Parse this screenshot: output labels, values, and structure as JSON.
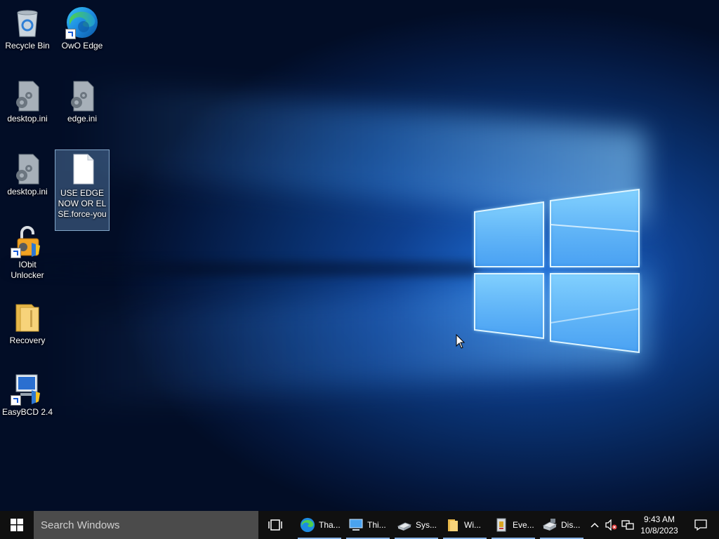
{
  "desktop": {
    "icons": [
      {
        "label": "Recycle Bin"
      },
      {
        "label": "OwO Edge"
      },
      {
        "label": "desktop.ini"
      },
      {
        "label": "edge.ini"
      },
      {
        "label": "desktop.ini"
      },
      {
        "label": "USE EDGE NOW OR ELSE.force-you"
      },
      {
        "label": "IObit Unlocker"
      },
      {
        "label": "Recovery"
      },
      {
        "label": "EasyBCD 2.4"
      }
    ]
  },
  "taskbar": {
    "search_placeholder": "Search Windows",
    "apps": [
      {
        "label": "Tha...",
        "icon": "edge-icon"
      },
      {
        "label": "Thi...",
        "icon": "this-pc-icon"
      },
      {
        "label": "Sys...",
        "icon": "drive-icon"
      },
      {
        "label": "Wi...",
        "icon": "folder-icon"
      },
      {
        "label": "Eve...",
        "icon": "event-viewer-icon"
      },
      {
        "label": "Dis...",
        "icon": "disk-management-icon"
      }
    ],
    "clock": {
      "time": "9:43 AM",
      "date": "10/8/2023"
    }
  },
  "colors": {
    "taskbar_bg": "#101010",
    "search_bg": "#4b4b4b",
    "accent": "#8ab4e8",
    "wallpaper_blue": "#1f6fd8"
  }
}
